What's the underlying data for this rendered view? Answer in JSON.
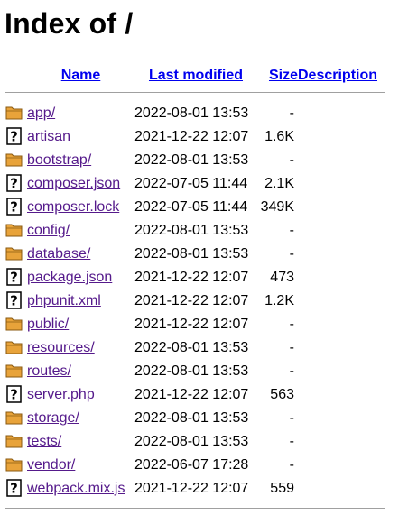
{
  "page": {
    "title": "Index of /"
  },
  "header": {
    "name": "Name",
    "last_modified": "Last modified",
    "size": "Size",
    "description": "Description"
  },
  "entries": [
    {
      "name": "app/",
      "modified": "2022-08-01 13:53",
      "size": "-",
      "icon": "folder-icon"
    },
    {
      "name": "artisan",
      "modified": "2021-12-22 12:07",
      "size": "1.6K",
      "icon": "unknown-file-icon"
    },
    {
      "name": "bootstrap/",
      "modified": "2022-08-01 13:53",
      "size": "-",
      "icon": "folder-icon"
    },
    {
      "name": "composer.json",
      "modified": "2022-07-05 11:44",
      "size": "2.1K",
      "icon": "unknown-file-icon"
    },
    {
      "name": "composer.lock",
      "modified": "2022-07-05 11:44",
      "size": "349K",
      "icon": "unknown-file-icon"
    },
    {
      "name": "config/",
      "modified": "2022-08-01 13:53",
      "size": "-",
      "icon": "folder-icon"
    },
    {
      "name": "database/",
      "modified": "2022-08-01 13:53",
      "size": "-",
      "icon": "folder-icon"
    },
    {
      "name": "package.json",
      "modified": "2021-12-22 12:07",
      "size": "473",
      "icon": "unknown-file-icon"
    },
    {
      "name": "phpunit.xml",
      "modified": "2021-12-22 12:07",
      "size": "1.2K",
      "icon": "unknown-file-icon"
    },
    {
      "name": "public/",
      "modified": "2021-12-22 12:07",
      "size": "-",
      "icon": "folder-icon"
    },
    {
      "name": "resources/",
      "modified": "2022-08-01 13:53",
      "size": "-",
      "icon": "folder-icon"
    },
    {
      "name": "routes/",
      "modified": "2022-08-01 13:53",
      "size": "-",
      "icon": "folder-icon"
    },
    {
      "name": "server.php",
      "modified": "2021-12-22 12:07",
      "size": "563",
      "icon": "unknown-file-icon"
    },
    {
      "name": "storage/",
      "modified": "2022-08-01 13:53",
      "size": "-",
      "icon": "folder-icon"
    },
    {
      "name": "tests/",
      "modified": "2022-08-01 13:53",
      "size": "-",
      "icon": "folder-icon"
    },
    {
      "name": "vendor/",
      "modified": "2022-06-07 17:28",
      "size": "-",
      "icon": "folder-icon"
    },
    {
      "name": "webpack.mix.js",
      "modified": "2021-12-22 12:07",
      "size": "559",
      "icon": "unknown-file-icon"
    }
  ],
  "colors": {
    "header_link": "#0000ee",
    "visited_link": "#551a8b",
    "folder_fill": "#e8a33a",
    "folder_stroke": "#8a5a10",
    "separator": "#a0a0a0"
  }
}
